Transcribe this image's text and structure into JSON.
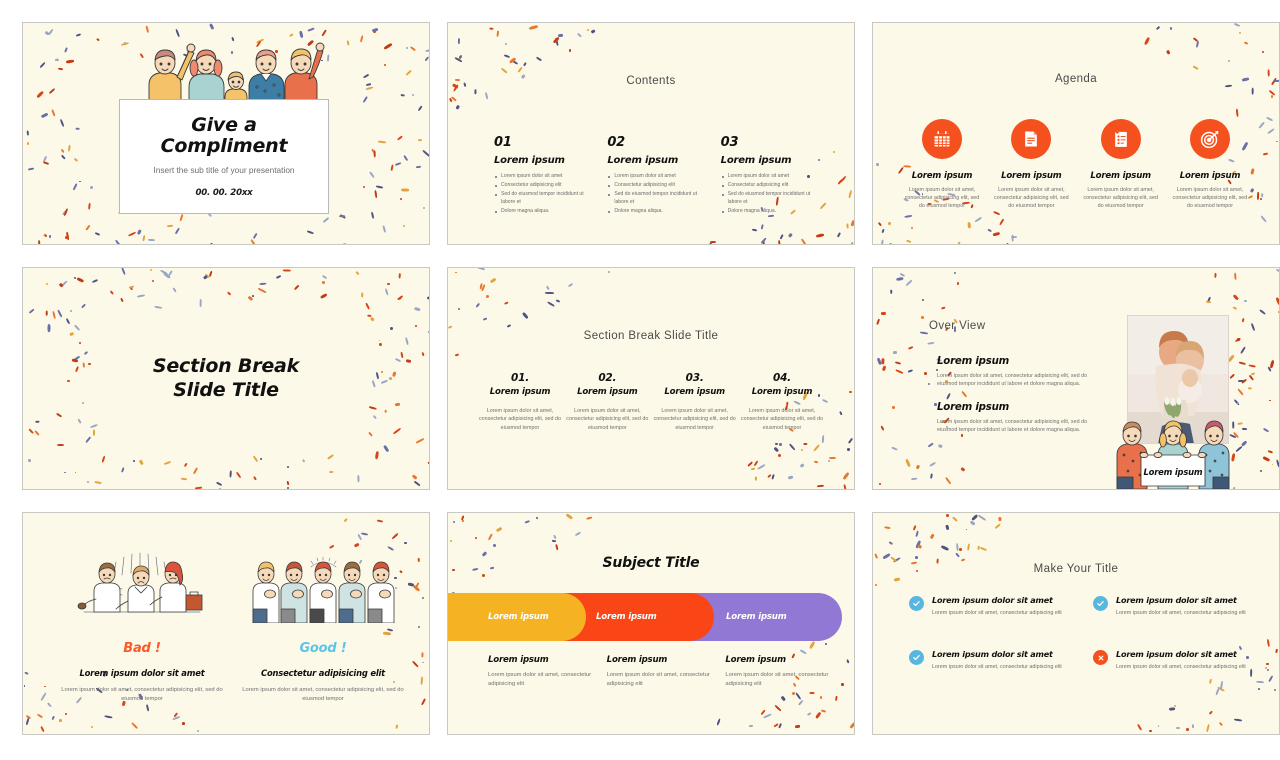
{
  "theme": {
    "slide_bg": "#FDF9E8",
    "page_bg": "#FFFFFF",
    "accent_orange": "#F4511E",
    "accent_yellow": "#F5B324",
    "accent_red_orange": "#FA4616",
    "accent_purple": "#9178D4",
    "accent_blue": "#56B8E0",
    "text_dark": "#111111",
    "text_muted": "#6F6F6F"
  },
  "confetti_colors": [
    "#D64518",
    "#E8762C",
    "#6A6FA8",
    "#4E5382",
    "#E3A33C",
    "#9AA7C4",
    "#C23B14"
  ],
  "slides": [
    {
      "id": "title-slide",
      "name": "Give a Compliment title slide",
      "title": "Give a\nCompliment",
      "title_line1": "Give a",
      "title_line2": "Compliment",
      "subtitle": "Insert the sub title of your presentation",
      "date": "00. 00. 20xx",
      "illustration": "five-people-waving-holding-sign"
    },
    {
      "id": "contents-slide",
      "name": "Contents slide",
      "heading": "Contents",
      "columns": [
        {
          "number": "01",
          "subtitle": "Lorem ipsum",
          "bullets": [
            "Lorem ipsum dolor sit amet",
            "Consectetur adipisicing elit",
            "Sed do eiusmod tempor incididunt ut labore et",
            "Dolore magna aliqua."
          ]
        },
        {
          "number": "02",
          "subtitle": "Lorem ipsum",
          "bullets": [
            "Lorem ipsum dolor sit amet",
            "Consectetur adipisicing elit",
            "Sed do eiusmod tempor incididunt ut labore et",
            "Dolore magna aliqua."
          ]
        },
        {
          "number": "03",
          "subtitle": "Lorem ipsum",
          "bullets": [
            "Lorem ipsum dolor sit amet",
            "Consectetur adipisicing elit",
            "Sed do eiusmod tempor incididunt ut labore et",
            "Dolore magna aliqua."
          ]
        }
      ]
    },
    {
      "id": "agenda-slide",
      "name": "Agenda slide",
      "heading": "Agenda",
      "items": [
        {
          "icon": "calendar-icon",
          "title": "Lorem ipsum",
          "text": "Lorem ipsum dolor sit amet, consectetur adipisicing elit, sed do eiusmod tempor"
        },
        {
          "icon": "document-icon",
          "title": "Lorem ipsum",
          "text": "Lorem ipsum dolor sit amet, consectetur adipisicing elit, sed do eiusmod tempor"
        },
        {
          "icon": "clipboard-list-icon",
          "title": "Lorem ipsum",
          "text": "Lorem ipsum dolor sit amet, consectetur adipisicing elit, sed do eiusmod tempor"
        },
        {
          "icon": "target-icon",
          "title": "Lorem ipsum",
          "text": "Lorem ipsum dolor sit amet, consectetur adipisicing elit, sed do eiusmod tempor"
        }
      ]
    },
    {
      "id": "section-break-slide",
      "name": "Section break slide",
      "title_line1": "Section Break",
      "title_line2": "Slide Title"
    },
    {
      "id": "section-break-columns-slide",
      "name": "Section break slide with four columns",
      "heading": "Section Break Slide Title",
      "columns": [
        {
          "number": "01.",
          "subtitle": "Lorem ipsum",
          "text": "Lorem ipsum dolor sit amet, consectetur adipisicing elit, sed do eiusmod tempor"
        },
        {
          "number": "02.",
          "subtitle": "Lorem ipsum",
          "text": "Lorem ipsum dolor sit amet, consectetur adipisicing elit, sed do eiusmod tempor"
        },
        {
          "number": "03.",
          "subtitle": "Lorem ipsum",
          "text": "Lorem ipsum dolor sit amet, consectetur adipisicing elit, sed do eiusmod tempor"
        },
        {
          "number": "04.",
          "subtitle": "Lorem ipsum",
          "text": "Lorem ipsum dolor sit amet, consectetur adipisicing elit, sed do eiusmod tempor"
        }
      ]
    },
    {
      "id": "over-view-slide",
      "name": "Over View slide",
      "heading": "Over View",
      "blocks": [
        {
          "title": "Lorem ipsum",
          "text": "Lorem ipsum dolor sit amet, consectetur adipisicing elit, sed do eiusmod tempor incididunt ut labore et dolore magna aliqua."
        },
        {
          "title": "Lorem ipsum",
          "text": "Lorem ipsum dolor sit amet, consectetur adipisicing elit, sed do eiusmod tempor incididunt ut labore et dolore magna aliqua."
        }
      ],
      "photo_alt": "family-hugging-photo",
      "sign_label": "Lorem ipsum",
      "illustration": "three-people-holding-sign"
    },
    {
      "id": "bad-good-slide",
      "name": "Bad versus Good comparison slide",
      "left": {
        "illustration": "people-arguing-pointing",
        "tag": "Bad !",
        "tag_color": "#FA5A2A",
        "subtitle": "Lorem ipsum dolor sit amet",
        "text": "Lorem ipsum dolor sit amet, consectetur adipisicing elit, sed do eiusmod tempor"
      },
      "right": {
        "illustration": "people-applauding-group",
        "tag": "Good !",
        "tag_color": "#5BC4E8",
        "subtitle": "Consectetur adipisicing elit",
        "text": "Lorem ipsum dolor sit amet, consectetur adipisicing elit, sed do eiusmod tempor"
      }
    },
    {
      "id": "subject-title-slide",
      "name": "Subject Title slide with colored bars",
      "heading": "Subject Title",
      "bars": [
        {
          "label": "Lorem ipsum",
          "color": "#F5B324"
        },
        {
          "label": "Lorem ipsum",
          "color": "#FA4616"
        },
        {
          "label": "Lorem ipsum",
          "color": "#9178D4"
        }
      ],
      "columns": [
        {
          "title": "Lorem ipsum",
          "text": "Lorem ipsum dolor sit amet, consectetur adipisicing elit"
        },
        {
          "title": "Lorem ipsum",
          "text": "Lorem ipsum dolor sit amet, consectetur adipisicing elit"
        },
        {
          "title": "Lorem ipsum",
          "text": "Lorem ipsum dolor sit amet, consectetur adipisicing elit"
        }
      ]
    },
    {
      "id": "make-your-title-slide",
      "name": "Make Your Title checklist slide",
      "heading": "Make Your Title",
      "items": [
        {
          "icon": "check-circle-icon",
          "color": "#56B8E0",
          "title": "Lorem ipsum dolor sit amet",
          "text": "Lorem ipsum dolor sit amet, consectetur adipiscing elit"
        },
        {
          "icon": "check-circle-icon",
          "color": "#56B8E0",
          "title": "Lorem ipsum dolor sit amet",
          "text": "Lorem ipsum dolor sit amet, consectetur adipiscing elit"
        },
        {
          "icon": "check-circle-icon",
          "color": "#56B8E0",
          "title": "Lorem ipsum dolor sit amet",
          "text": "Lorem ipsum dolor sit amet, consectetur adipiscing elit"
        },
        {
          "icon": "x-circle-icon",
          "color": "#F4511E",
          "title": "Lorem ipsum dolor sit amet",
          "text": "Lorem ipsum dolor sit amet, consectetur adipiscing elit"
        }
      ]
    }
  ]
}
